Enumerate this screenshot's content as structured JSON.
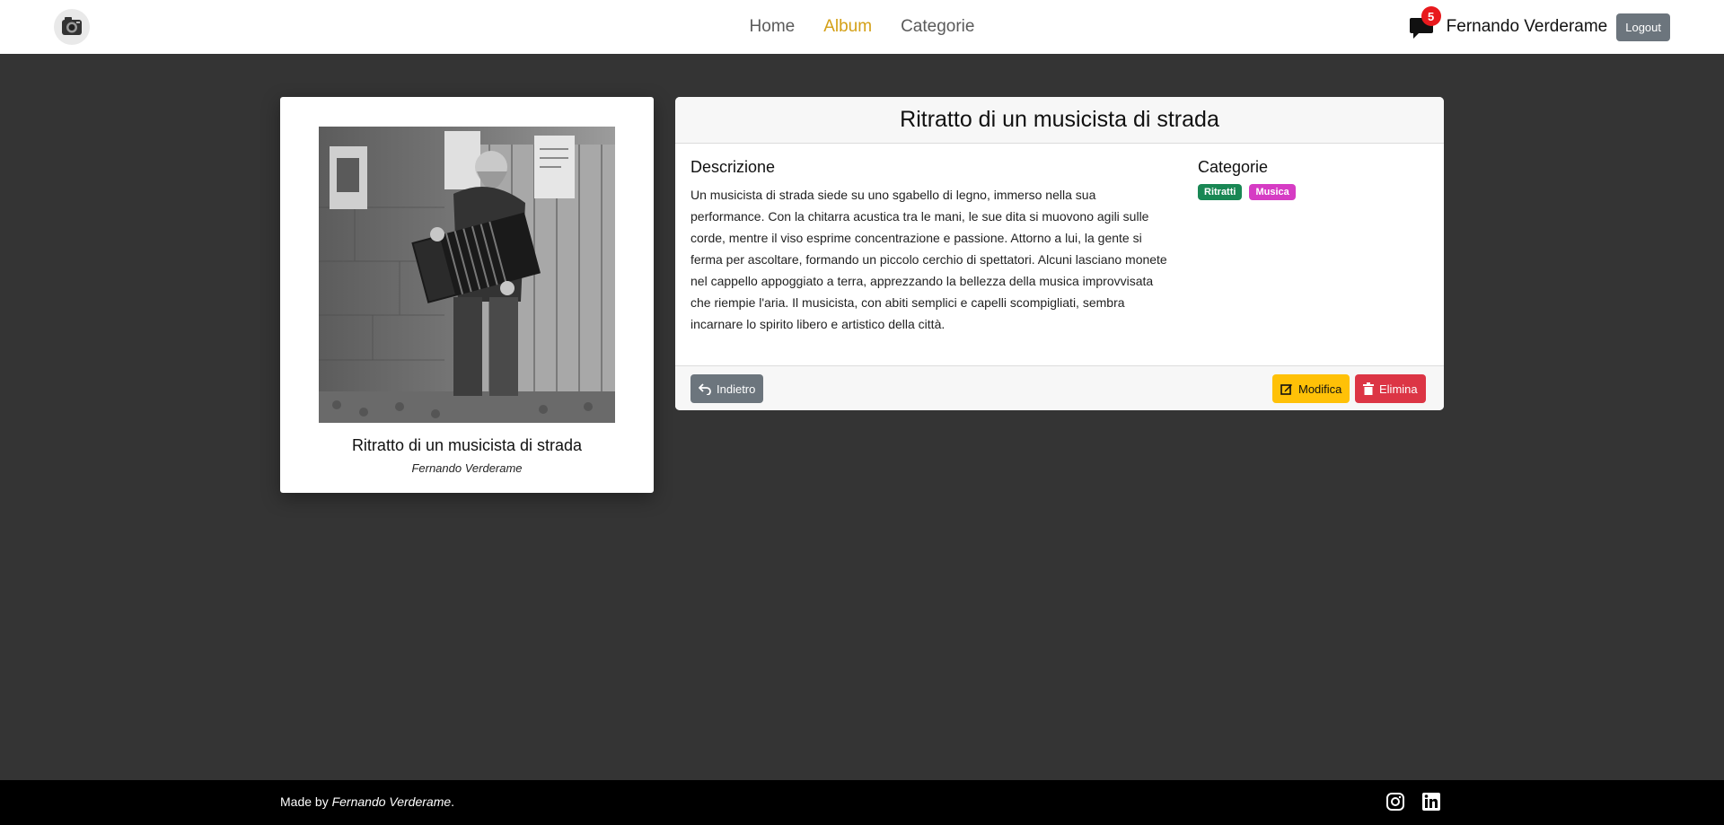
{
  "nav": {
    "links": [
      {
        "label": "Home",
        "active": false
      },
      {
        "label": "Album",
        "active": true
      },
      {
        "label": "Categorie",
        "active": false
      }
    ],
    "notification_count": "5",
    "user_name": "Fernando Verderame",
    "logout_label": "Logout",
    "active_color": "#d4a017"
  },
  "photo_card": {
    "caption": "Ritratto di un musicista di strada",
    "author": "Fernando Verderame"
  },
  "detail": {
    "title": "Ritratto di un musicista di strada",
    "description_heading": "Descrizione",
    "description": "Un musicista di strada siede su uno sgabello di legno, immerso nella sua performance. Con la chitarra acustica tra le mani, le sue dita si muovono agili sulle corde, mentre il viso esprime concentrazione e passione. Attorno a lui, la gente si ferma per ascoltare, formando un piccolo cerchio di spettatori. Alcuni lasciano monete nel cappello appoggiato a terra, apprezzando la bellezza della musica improvvisata che riempie l'aria. Il musicista, con abiti semplici e capelli scompigliati, sembra incarnare lo spirito libero e artistico della città.",
    "categories_heading": "Categorie",
    "categories": [
      {
        "label": "Ritratti",
        "color": "#198754"
      },
      {
        "label": "Musica",
        "color": "#d63cc4"
      }
    ],
    "back_label": "Indietro",
    "edit_label": "Modifica",
    "delete_label": "Elimina"
  },
  "footer": {
    "made_by_prefix": "Made by",
    "made_by_name": "Fernando Verderame",
    "made_by_suffix": ".",
    "social_icons": [
      "instagram-icon",
      "linkedin-icon"
    ]
  }
}
